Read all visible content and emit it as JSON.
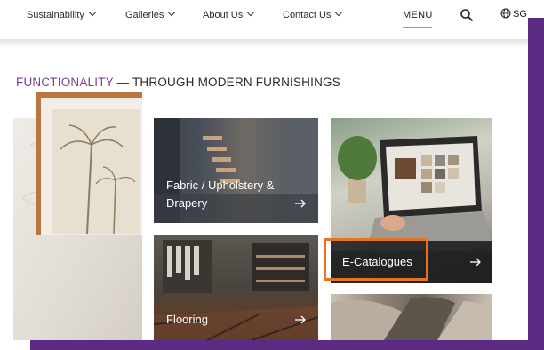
{
  "nav": {
    "items": [
      {
        "label": "Sustainability"
      },
      {
        "label": "Galleries"
      },
      {
        "label": "About Us"
      },
      {
        "label": "Contact Us"
      }
    ],
    "menu_label": "MENU",
    "search_icon": "search-icon",
    "lang_icon": "globe-icon",
    "lang_label": "SG"
  },
  "section": {
    "heading_accent": "FUNCTIONALITY",
    "heading_rest": " — THROUGH MODERN FURNISHINGS"
  },
  "tiles": {
    "fabric": {
      "line1": "Fabric / Upholstery &",
      "line2": "Drapery"
    },
    "flooring": {
      "label": "Flooring"
    },
    "ecatalogues": {
      "label": "E-Catalogues"
    }
  },
  "colors": {
    "accent": "#7a3f8f",
    "frame": "#5b2a83",
    "highlight": "#e8731f"
  }
}
